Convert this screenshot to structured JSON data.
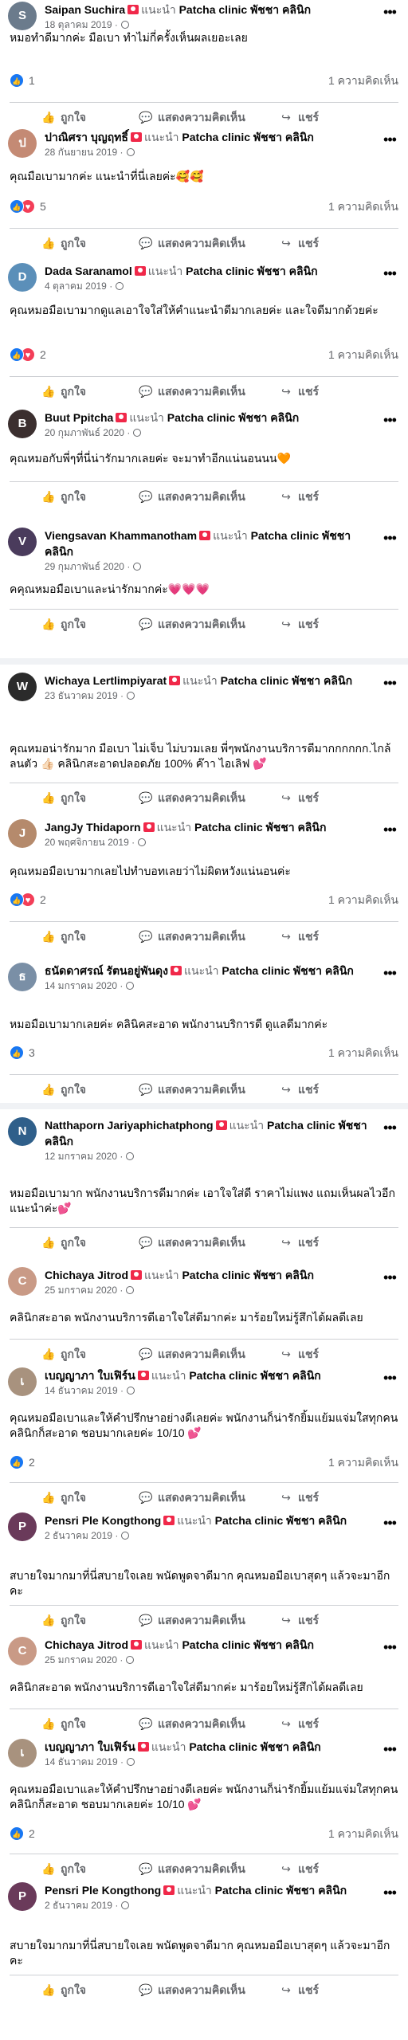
{
  "ui": {
    "recommends": "แนะนำ",
    "page_name": "Patcha clinic พัชชา คลินิก",
    "actions": {
      "like": "ถูกใจ",
      "comment": "แสดงความคิดเห็น",
      "share": "แชร์"
    },
    "icons": {
      "like": "like-icon",
      "comment": "comment-icon",
      "share": "share-icon",
      "more": "more-icon",
      "globe": "globe-icon",
      "recommend": "recommend-icon"
    },
    "colors": {
      "accent": "#1877f2",
      "love": "#f33e58",
      "recommend": "#f02849",
      "muted": "#65676b",
      "separator": "#f0f2f5"
    }
  },
  "reviews": [
    {
      "name": "Saipan Suchira",
      "date": "18 ตุลาคม 2019",
      "text": "หมอทำดีมากค่ะ มือเบา ทำไม่กี่ครั้งเห็นผลเยอะเลย",
      "reactions": [
        "like"
      ],
      "reaction_count": "1",
      "comments": "1 ความคิดเห็น",
      "avatar": "S",
      "avatar_color": "#6b7b8c"
    },
    {
      "name": "ปาณิศรา บุญฤทธิ์",
      "date": "28 กันยายน 2019",
      "text": "คุณมือเบามากค่ะ แนะนำที่นี่เลยค่ะ🥰🥰",
      "reactions": [
        "like",
        "love"
      ],
      "reaction_count": "5",
      "comments": "1 ความคิดเห็น",
      "avatar": "ป",
      "avatar_color": "#c48a74"
    },
    {
      "name": "Dada Saranamol",
      "date": "4 ตุลาคม 2019",
      "text": "คุณหมอมือเบามากดูแลเอาใจใส่ให้คำแนะนำดีมากเลยค่ะ และใจดีมากด้วยค่ะ",
      "reactions": [
        "like",
        "love"
      ],
      "reaction_count": "2",
      "comments": "1 ความคิดเห็น",
      "avatar": "D",
      "avatar_color": "#5b8fb9"
    },
    {
      "name": "Buut Ppitcha",
      "date": "20 กุมภาพันธ์ 2020",
      "text": "คุณหมอกับพี่ๆที่นี่น่ารักมากเลยค่ะ จะมาทำอีกแน่นอนนน🧡",
      "reactions": [],
      "reaction_count": "",
      "comments": "",
      "avatar": "B",
      "avatar_color": "#3b2f2f"
    },
    {
      "name": "Viengsavan Khammanotham",
      "date": "29 กุมภาพันธ์ 2020",
      "text": "คคุณหมอมือเบาและน่ารักมากค่ะ💗💗💗",
      "reactions": [],
      "reaction_count": "",
      "comments": "",
      "avatar": "V",
      "avatar_color": "#4a3b5c"
    },
    {
      "name": "Wichaya Lertlimpiyarat",
      "date": "23 ธันวาคม 2019",
      "text": "คุณหมอน่ารักมาก มือเบา ไม่เจ็บ ไม่บวมเลย พี่ๆพนักงานบริการดีมากกกกกก.ไกล้ลนตัว 👍🏻 คลินิกสะอาดปลอดภัย 100% ค๊าา ไอเลิฟ 💕",
      "reactions": [],
      "reaction_count": "",
      "comments": "",
      "avatar": "W",
      "avatar_color": "#2b2b2b"
    },
    {
      "name": "JangJy Thidaporn",
      "date": "20 พฤศจิกายน 2019",
      "text": "คุณหมอมือเบามากเลยไปทำบอทเลยว่าไม่ผิดหวังแน่นอนค่ะ",
      "reactions": [
        "like",
        "love"
      ],
      "reaction_count": "2",
      "comments": "1 ความคิดเห็น",
      "avatar": "J",
      "avatar_color": "#b58a6c"
    },
    {
      "name": "ธนัดดาศรณ์ รัตนอยู่พันดุง",
      "date": "14 มกราคม 2020",
      "text": "หมอมือเบามากเลยค่ะ คลินิคสะอาด พนักงานบริการดี ดูแลดีมากค่ะ",
      "reactions": [
        "like"
      ],
      "reaction_count": "3",
      "comments": "1 ความคิดเห็น",
      "avatar": "ธ",
      "avatar_color": "#7a8fa6"
    },
    {
      "name": "Natthaporn Jariyaphichatphong",
      "date": "12 มกราคม 2020",
      "text": "หมอมือเบามาก พนักงานบริการดีมากค่ะ เอาใจใส่ดี ราคาไม่แพง แถมเห็นผลไวอีก แนะนำค่ะ💕",
      "reactions": [],
      "reaction_count": "",
      "comments": "",
      "avatar": "N",
      "avatar_color": "#2f5f8a"
    },
    {
      "name": "Chichaya Jitrod",
      "date": "25 มกราคม 2020",
      "text": "คลินิกสะอาด พนักงานบริการดีเอาใจใส่ดีมากค่ะ มาร้อยใหม่รู้สึกได้ผลดีเลย",
      "reactions": [],
      "reaction_count": "",
      "comments": "",
      "avatar": "C",
      "avatar_color": "#c99a86"
    },
    {
      "name": "เบญญาภา ใบเฟิร์น",
      "date": "14 ธันวาคม 2019",
      "text": "คุณหมอมือเบาและให้คำปรึกษาอย่างดีเลยค่ะ พนักงานก็น่ารักยิ้มแย้มแจ่มใสทุกคน คลินิกก็สะอาด ชอบมากเลยค่ะ 10/10 💕",
      "reactions": [
        "like"
      ],
      "reaction_count": "2",
      "comments": "1 ความคิดเห็น",
      "avatar": "เ",
      "avatar_color": "#a8927e"
    },
    {
      "name": "Pensri Ple Kongthong",
      "date": "2 ธันวาคม 2019",
      "text": "สบายใจมากมาที่นี่สบายใจเลย พนัดพูดจาดีมาก คุณหมอมือเบาสุดๆ แล้วจะมาอีกคะ",
      "reactions": [],
      "reaction_count": "",
      "comments": "",
      "avatar": "P",
      "avatar_color": "#6a3a5a"
    },
    {
      "name": "Chichaya Jitrod",
      "date": "25 มกราคม 2020",
      "text": "คลินิกสะอาด พนักงานบริการดีเอาใจใส่ดีมากค่ะ มาร้อยใหม่รู้สึกได้ผลดีเลย",
      "reactions": [],
      "reaction_count": "",
      "comments": "",
      "avatar": "C",
      "avatar_color": "#c99a86"
    },
    {
      "name": "เบญญาภา ใบเฟิร์น",
      "date": "14 ธันวาคม 2019",
      "text": "คุณหมอมือเบาและให้คำปรึกษาอย่างดีเลยค่ะ พนักงานก็น่ารักยิ้มแย้มแจ่มใสทุกคน คลินิกก็สะอาด ชอบมากเลยค่ะ 10/10 💕",
      "reactions": [
        "like"
      ],
      "reaction_count": "2",
      "comments": "1 ความคิดเห็น",
      "avatar": "เ",
      "avatar_color": "#a8927e"
    },
    {
      "name": "Pensri Ple Kongthong",
      "date": "2 ธันวาคม 2019",
      "text": "สบายใจมากมาที่นี่สบายใจเลย พนัดพูดจาดีมาก คุณหมอมือเบาสุดๆ แล้วจะมาอีกคะ",
      "reactions": [],
      "reaction_count": "",
      "comments": "",
      "avatar": "P",
      "avatar_color": "#6a3a5a"
    }
  ]
}
